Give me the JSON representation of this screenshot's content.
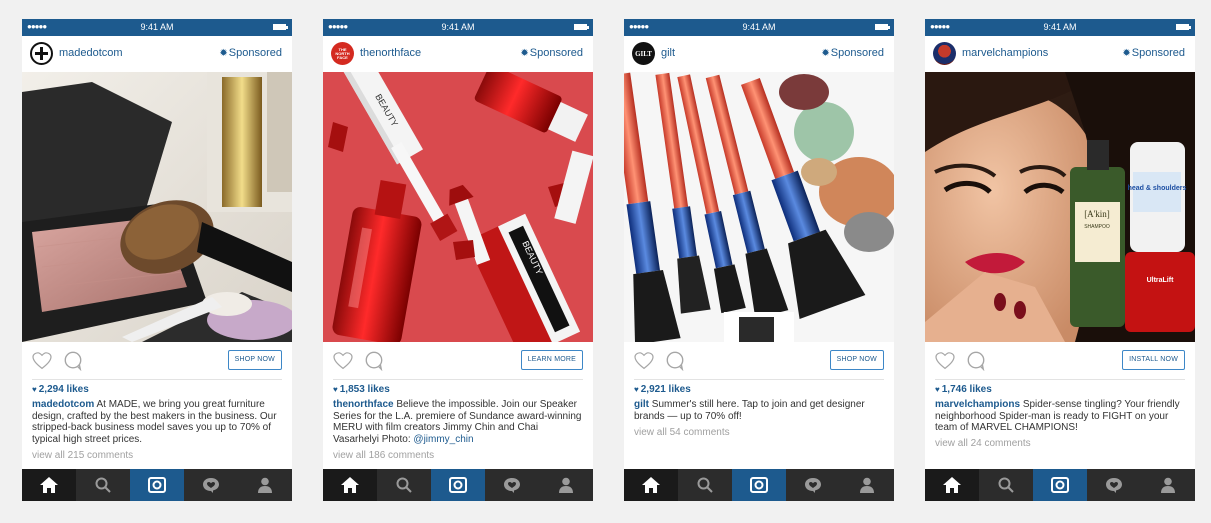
{
  "status_bar": {
    "signal": "●●●●●",
    "time": "9:41 AM"
  },
  "posts": [
    {
      "username": "madedotcom",
      "sponsored_label": "Sponsored",
      "cta_label": "SHOP NOW",
      "likes": "2,294 likes",
      "caption_user": "madedotcom",
      "caption_text": " At MADE, we bring you great furniture design, crafted by the best makers in the business. Our stripped-back business model saves you up to 70% of typical high street prices.",
      "view_all": "view all 215 comments"
    },
    {
      "username": "thenorthface",
      "avatar_text": "THE NORTH FACE",
      "sponsored_label": "Sponsored",
      "cta_label": "LEARN MORE",
      "likes": "1,853 likes",
      "caption_user": "thenorthface",
      "caption_text": " Believe the impossible. Join our Speaker Series for the L.A. premiere of Sundance award-winning MERU with film creators Jimmy Chin and Chai Vasarhelyi Photo: ",
      "caption_mention": "@jimmy_chin",
      "view_all": "view all 186 comments"
    },
    {
      "username": "gilt",
      "avatar_text": "GILT",
      "sponsored_label": "Sponsored",
      "cta_label": "SHOP NOW",
      "likes": "2,921 likes",
      "caption_user": "gilt",
      "caption_text": " Summer's still here. Tap to join and get designer brands — up to 70% off!",
      "view_all": "view all 54 comments"
    },
    {
      "username": "marvelchampions",
      "sponsored_label": "Sponsored",
      "cta_label": "INSTALL NOW",
      "likes": "1,746 likes",
      "caption_user": "marvelchampions",
      "caption_text": " Spider-sense tingling? Your friendly neighborhood Spider-man is ready to FIGHT on your team of MARVEL CHAMPIONS!",
      "view_all": "view all 24 comments"
    }
  ],
  "image_text": {
    "beauty": "BEAUTY",
    "akin_brand": "[A'kin]",
    "akin_product": "SHAMPOO",
    "hs_brand": "head & shoulders",
    "ultra_brand": "UltraLift"
  },
  "icons": {
    "sponsored": "gear-icon",
    "likes": "heart-icon",
    "nav": [
      "home-icon",
      "search-icon",
      "camera-icon",
      "activity-icon",
      "profile-icon"
    ]
  },
  "colors": {
    "brand_blue": "#1d5a8e",
    "cta_border": "#3d87c7",
    "nav_bg": "#2c2c2c",
    "page_bg": "#f1f1f1"
  }
}
